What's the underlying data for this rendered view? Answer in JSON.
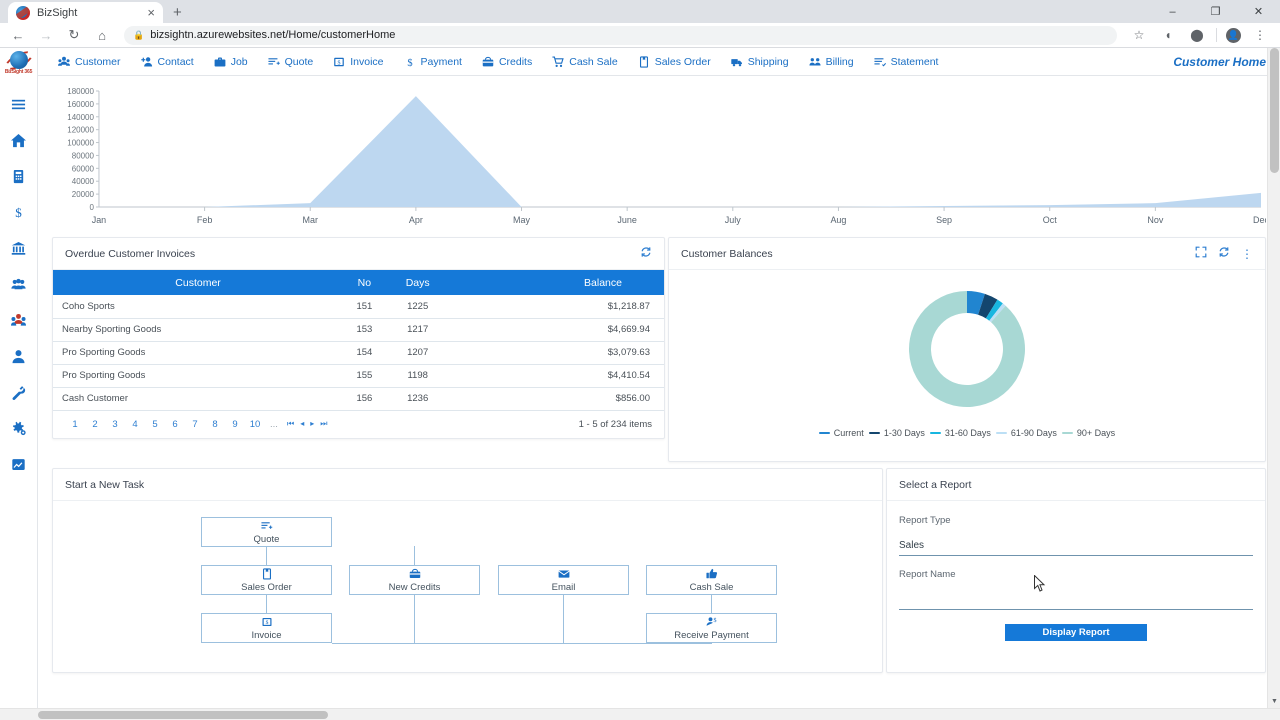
{
  "browser": {
    "tab_title": "BizSight",
    "tab_close_label": "×",
    "new_tab_label": "+",
    "url": "bizsightn.azurewebsites.net/Home/customerHome",
    "lock_icon": "lock-icon",
    "back_label": "←",
    "forward_label": "→",
    "reload_label": "↻",
    "home_label": "⌂",
    "bookmark_label": "☆",
    "minimize_label": "–",
    "maximize_label": "❐",
    "close_label": "✕",
    "menu_label": "⋮"
  },
  "app": {
    "logo_text": "BizSight 365",
    "page_title": "Customer Home"
  },
  "sidebar": {
    "items": [
      {
        "icon": "hamburger-menu-icon",
        "name": "menu-toggle"
      },
      {
        "icon": "home-icon",
        "name": "home"
      },
      {
        "icon": "building-icon",
        "name": "company"
      },
      {
        "icon": "dollar-icon",
        "name": "finance"
      },
      {
        "icon": "bank-icon",
        "name": "banking"
      },
      {
        "icon": "people-group-icon",
        "name": "contacts"
      },
      {
        "icon": "customers-icon",
        "name": "customers"
      },
      {
        "icon": "person-icon",
        "name": "user"
      },
      {
        "icon": "wrench-icon",
        "name": "tools"
      },
      {
        "icon": "gears-icon",
        "name": "settings"
      },
      {
        "icon": "report-chart-icon",
        "name": "reports"
      }
    ]
  },
  "topnav": {
    "items": [
      {
        "label": "Customer",
        "icon": "customers-icon"
      },
      {
        "label": "Contact",
        "icon": "add-person-icon"
      },
      {
        "label": "Job",
        "icon": "briefcase-icon"
      },
      {
        "label": "Quote",
        "icon": "quote-lines-icon"
      },
      {
        "label": "Invoice",
        "icon": "invoice-icon"
      },
      {
        "label": "Payment",
        "icon": "dollar-icon"
      },
      {
        "label": "Credits",
        "icon": "credits-bag-icon"
      },
      {
        "label": "Cash Sale",
        "icon": "cart-icon"
      },
      {
        "label": "Sales Order",
        "icon": "order-doc-icon"
      },
      {
        "label": "Shipping",
        "icon": "truck-icon"
      },
      {
        "label": "Billing",
        "icon": "people-group-icon"
      },
      {
        "label": "Statement",
        "icon": "statement-icon"
      }
    ]
  },
  "chart_data": {
    "type": "area",
    "title": "",
    "xlabel": "",
    "ylabel": "",
    "categories": [
      "Jan",
      "Feb",
      "Mar",
      "Apr",
      "May",
      "June",
      "July",
      "Aug",
      "Sep",
      "Oct",
      "Nov",
      "Dec"
    ],
    "values": [
      0,
      0,
      6000,
      172000,
      0,
      0,
      0,
      0,
      1500,
      3000,
      6000,
      22000
    ],
    "ytick_labels": [
      "180000",
      "160000",
      "140000",
      "120000",
      "100000",
      "80000",
      "60000",
      "40000",
      "20000",
      "0"
    ],
    "ylim": [
      0,
      180000
    ],
    "ytick_step": 20000,
    "grid": false,
    "legend": "none",
    "series_color": "#bdd7f0",
    "axis_color": "#bfc6cc"
  },
  "overdue_card": {
    "title": "Overdue Customer Invoices",
    "refresh_icon": "refresh-icon",
    "columns": [
      "Customer",
      "No",
      "Days",
      "Balance"
    ],
    "rows": [
      {
        "customer": "Coho Sports",
        "no": "151",
        "days": "1225",
        "balance": "$1,218.87"
      },
      {
        "customer": "Nearby Sporting Goods",
        "no": "153",
        "days": "1217",
        "balance": "$4,669.94"
      },
      {
        "customer": "Pro Sporting Goods",
        "no": "154",
        "days": "1207",
        "balance": "$3,079.63"
      },
      {
        "customer": "Pro Sporting Goods",
        "no": "155",
        "days": "1198",
        "balance": "$4,410.54"
      },
      {
        "customer": "Cash Customer",
        "no": "156",
        "days": "1236",
        "balance": "$856.00"
      }
    ],
    "pages": [
      "1",
      "2",
      "3",
      "4",
      "5",
      "6",
      "7",
      "8",
      "9",
      "10"
    ],
    "pages_ellipsis": "...",
    "nav_first": "⏮",
    "nav_prev": "◂",
    "nav_next": "▸",
    "nav_last": "⏭",
    "items_info": "1 - 5 of 234 items"
  },
  "balances_card": {
    "title": "Customer Balances",
    "expand_icon": "expand-icon",
    "refresh_icon": "refresh-icon",
    "more_icon": "kebab-menu-icon",
    "chart": {
      "type": "pie",
      "title": "Customer Balances",
      "labels": [
        "Current",
        "1-30 Days",
        "31-60 Days",
        "61-90 Days",
        "90+ Days"
      ],
      "values": [
        5.0,
        3.8,
        1.8,
        1.0,
        88.4
      ],
      "colors": [
        "#2185d0",
        "#14466e",
        "#18b6e0",
        "#bcdff5",
        "#a8d8d4"
      ],
      "legend_position": "bottom",
      "donut": true
    }
  },
  "task_card": {
    "title": "Start a New Task",
    "nodes": [
      {
        "label": "Quote",
        "icon": "quote-lines-icon"
      },
      {
        "label": "Sales Order",
        "icon": "order-doc-icon"
      },
      {
        "label": "Invoice",
        "icon": "invoice-icon"
      },
      {
        "label": "New Credits",
        "icon": "credits-bag-icon"
      },
      {
        "label": "Email",
        "icon": "email-icon"
      },
      {
        "label": "Cash Sale",
        "icon": "thumbs-up-icon"
      },
      {
        "label": "Receive Payment",
        "icon": "receive-payment-icon"
      }
    ]
  },
  "report_card": {
    "title": "Select a Report",
    "report_type_label": "Report Type",
    "report_type_value": "Sales",
    "report_name_label": "Report Name",
    "report_name_value": "",
    "report_name_placeholder": "",
    "display_button": "Display Report"
  }
}
